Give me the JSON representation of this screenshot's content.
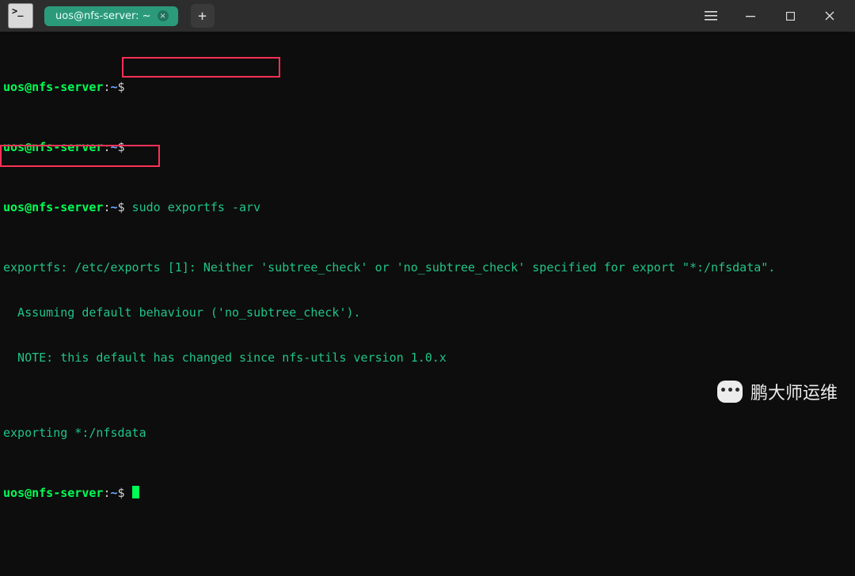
{
  "titlebar": {
    "tab_label": "uos@nfs-server: ~",
    "tab_close_glyph": "×",
    "newtab_glyph": "+"
  },
  "prompt": {
    "user": "uos",
    "at": "@",
    "host": "nfs-server",
    "colon": ":",
    "path": "~",
    "dollar": "$"
  },
  "lines": {
    "blank": "",
    "cmd1": "sudo exportfs -arv",
    "out1": "exportfs: /etc/exports [1]: Neither 'subtree_check' or 'no_subtree_check' specified for export \"*:/nfsdata\".",
    "out2": "  Assuming default behaviour ('no_subtree_check').",
    "out3": "  NOTE: this default has changed since nfs-utils version 1.0.x",
    "out4": "",
    "out5": "exporting *:/nfsdata"
  },
  "watermark": {
    "text": "鹏大师运维"
  },
  "colors": {
    "accent_tab": "#2b9a7b",
    "prompt_green": "#00ff55",
    "path_blue": "#6fa9ff",
    "stdout_green": "#20c488",
    "highlight_red": "#ff3056"
  }
}
